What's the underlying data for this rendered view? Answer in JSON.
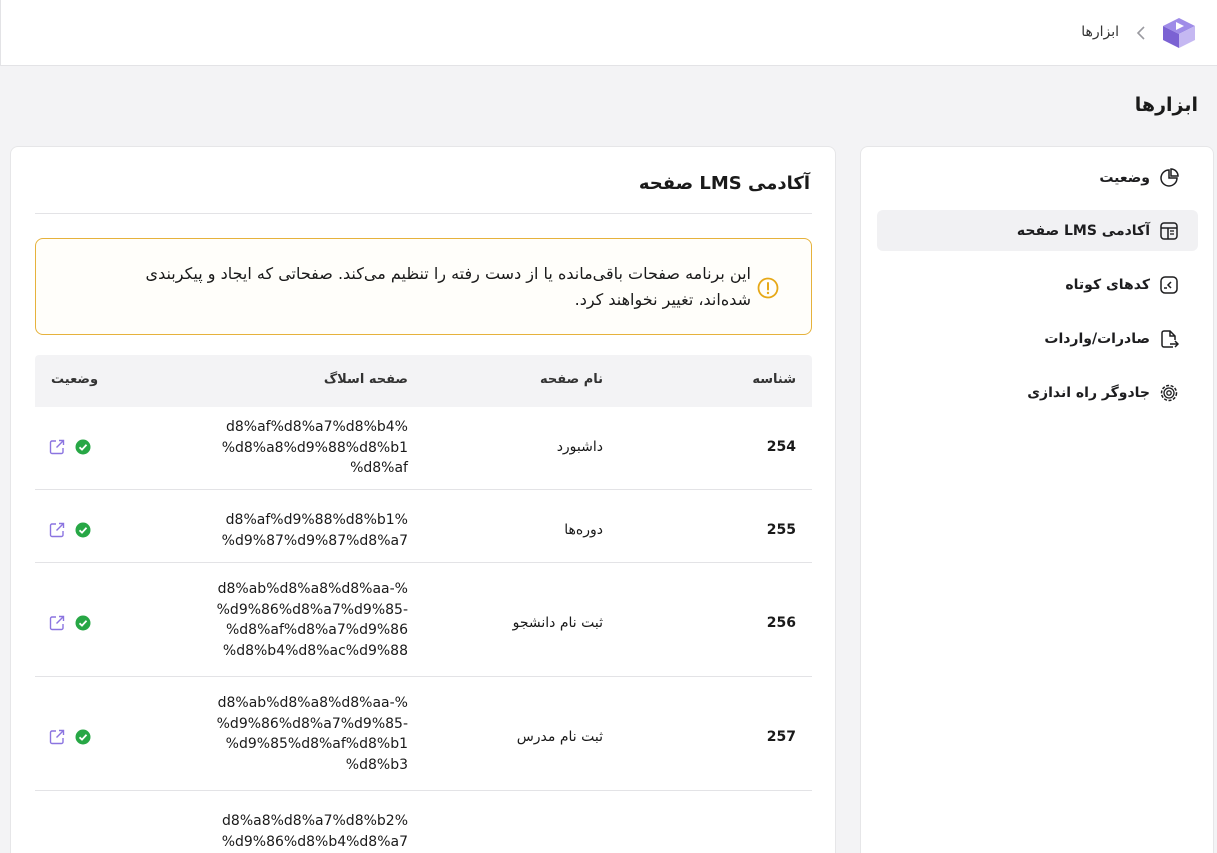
{
  "header": {
    "breadcrumb": "ابزارها"
  },
  "page": {
    "title": "ابزارها"
  },
  "sidebar": {
    "items": [
      {
        "label": "وضعیت",
        "icon": "pie-chart-icon",
        "active": false
      },
      {
        "label": "آکادمی LMS صفحه",
        "icon": "layout-icon",
        "active": true
      },
      {
        "label": "کدهای کوتاه",
        "icon": "terminal-icon",
        "active": false
      },
      {
        "label": "صادرات/واردات",
        "icon": "file-export-icon",
        "active": false
      },
      {
        "label": "جادوگر راه اندازی",
        "icon": "gear-icon",
        "active": false
      }
    ]
  },
  "main": {
    "title": "آکادمی LMS صفحه",
    "notice": "این برنامه صفحات باقی‌مانده یا از دست رفته را تنظیم می‌کند. صفحاتی که ایجاد و پیکربندی شده‌اند، تغییر نخواهند کرد.",
    "table": {
      "columns": [
        "شناسه",
        "نام صفحه",
        "صفحه اسلاگ",
        "وضعیت"
      ],
      "rows": [
        {
          "id": "254",
          "name": "داشبورد",
          "slug": "d8%af%d8%a7%d8%b4%\n%d8%a8%d9%88%d8%b1\n%d8%af"
        },
        {
          "id": "255",
          "name": "دوره‌ها",
          "slug": "d8%af%d9%88%d8%b1%\n%d9%87%d9%87%d8%a7"
        },
        {
          "id": "256",
          "name": "ثبت نام دانشجو",
          "slug": "d8%ab%d8%a8%d8%aa-%\n%d9%86%d8%a7%d9%85-\n%d8%af%d8%a7%d9%86\n%d8%b4%d8%ac%d9%88"
        },
        {
          "id": "257",
          "name": "ثبت نام مدرس",
          "slug": "d8%ab%d8%a8%d8%aa-%\n%d9%86%d8%a7%d9%85-\n%d9%85%d8%af%d8%b1\n%d8%b3"
        },
        {
          "id": "",
          "name": "",
          "slug": "d8%a8%d8%a7%d8%b2%\n%d9%86%d8%b4%d8%a7"
        }
      ]
    }
  },
  "colors": {
    "accent": "#7c5cd6",
    "warning": "#e6b23c",
    "success": "#27a745"
  }
}
